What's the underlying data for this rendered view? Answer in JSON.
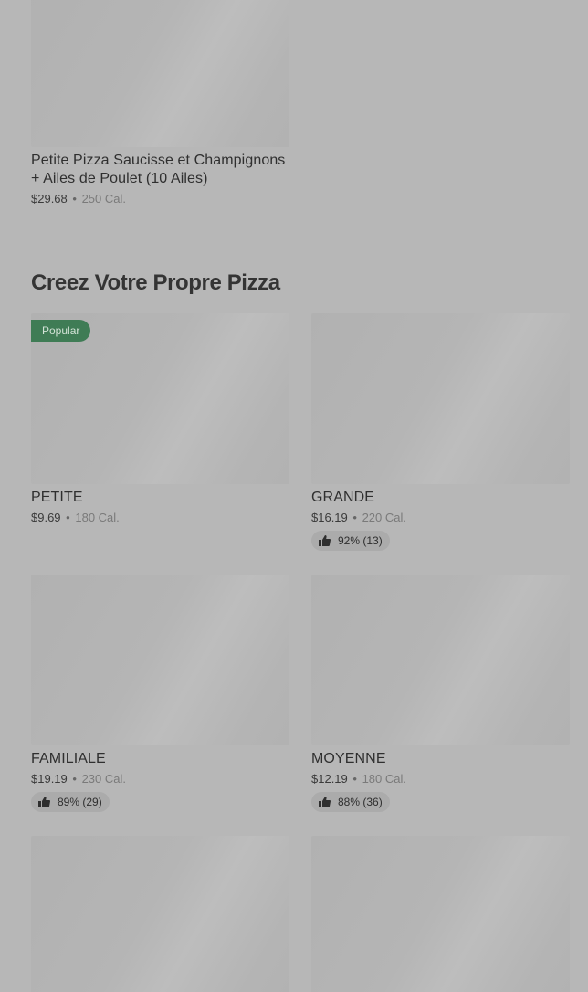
{
  "top_item": {
    "name": "Petite Pizza Saucisse et Champignons + Ailes de Poulet (10 Ailes)",
    "price": "$29.68",
    "calories": "250 Cal."
  },
  "section": {
    "title": "Creez Votre Propre Pizza"
  },
  "items": [
    {
      "name": "PETITE",
      "price": "$9.69",
      "calories": "180 Cal.",
      "badge": "Popular"
    },
    {
      "name": "GRANDE",
      "price": "$16.19",
      "calories": "220 Cal.",
      "rating": "92% (13)",
      "rating_icon": "thumbs-up-icon"
    },
    {
      "name": "FAMILIALE",
      "price": "$19.19",
      "calories": "230 Cal.",
      "rating": "89% (29)",
      "rating_icon": "thumbs-up-icon"
    },
    {
      "name": "MOYENNE",
      "price": "$12.19",
      "calories": "180 Cal.",
      "rating": "88% (36)",
      "rating_icon": "thumbs-up-icon"
    }
  ],
  "separator": "•",
  "colors": {
    "overlay_background": "#b7b7b7",
    "popular_badge": "#3f7c55",
    "rating_pill": "#ababab"
  }
}
